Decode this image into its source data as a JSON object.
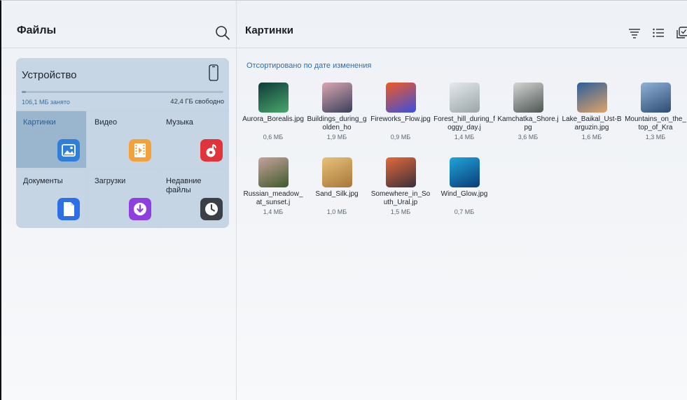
{
  "left": {
    "title": "Файлы",
    "device": {
      "title": "Устройство",
      "used": "106,1 МБ занято",
      "free": "42,4 ГБ свободно",
      "used_fraction": 0.002
    },
    "categories": [
      {
        "label": "Картинки",
        "icon": "image-icon",
        "color": "#2f7fd8"
      },
      {
        "label": "Видео",
        "icon": "film-icon",
        "color": "#f2a23a"
      },
      {
        "label": "Музыка",
        "icon": "music-icon",
        "color": "#e0333a"
      },
      {
        "label": "Документы",
        "icon": "document-icon",
        "color": "#2e6fe6"
      },
      {
        "label": "Загрузки",
        "icon": "download-icon",
        "color": "#8f3fe0"
      },
      {
        "label": "Недавние файлы",
        "icon": "clock-icon",
        "color": "#3b3f46"
      }
    ]
  },
  "right": {
    "title": "Картинки",
    "sort_label": "Отсортировано по дате изменения",
    "files": [
      {
        "name": "Aurora_Borealis.jpg",
        "size": "0,6 МБ",
        "colors": [
          "#0d3b3a",
          "#4aa66a"
        ]
      },
      {
        "name": "Buildings_during_golden_ho",
        "size": "1,9 МБ",
        "colors": [
          "#d9a7b0",
          "#3a3f5c"
        ]
      },
      {
        "name": "Fireworks_Flow.jpg",
        "size": "0,9 МБ",
        "colors": [
          "#f05a22",
          "#3a4fe0"
        ]
      },
      {
        "name": "Forest_hill_during_foggy_day.j",
        "size": "1,4 МБ",
        "colors": [
          "#e6e9ec",
          "#9aa5a8"
        ]
      },
      {
        "name": "Kamchatka_Shore.jpg",
        "size": "3,6 МБ",
        "colors": [
          "#d4d6d5",
          "#4d5552"
        ]
      },
      {
        "name": "Lake_Baikal_Ust-Barguzin.jpg",
        "size": "1,6 МБ",
        "colors": [
          "#2a5f9a",
          "#e0a36a"
        ]
      },
      {
        "name": "Mountains_on_the_top_of_Kra",
        "size": "1,3 МБ",
        "colors": [
          "#8fb2d8",
          "#2e4b72"
        ]
      },
      {
        "name": "Russian_meadow_at_sunset.j",
        "size": "1,4 МБ",
        "colors": [
          "#c6a29a",
          "#3f5a2c"
        ]
      },
      {
        "name": "Sand_Silk.jpg",
        "size": "1,0 МБ",
        "colors": [
          "#e6c27a",
          "#a8753a"
        ]
      },
      {
        "name": "Somewhere_in_South_Ural.jp",
        "size": "1,5 МБ",
        "colors": [
          "#e26a3a",
          "#3b2f3a"
        ]
      },
      {
        "name": "Wind_Glow.jpg",
        "size": "0,7 МБ",
        "colors": [
          "#1fa6d8",
          "#0b3a78"
        ]
      }
    ]
  }
}
